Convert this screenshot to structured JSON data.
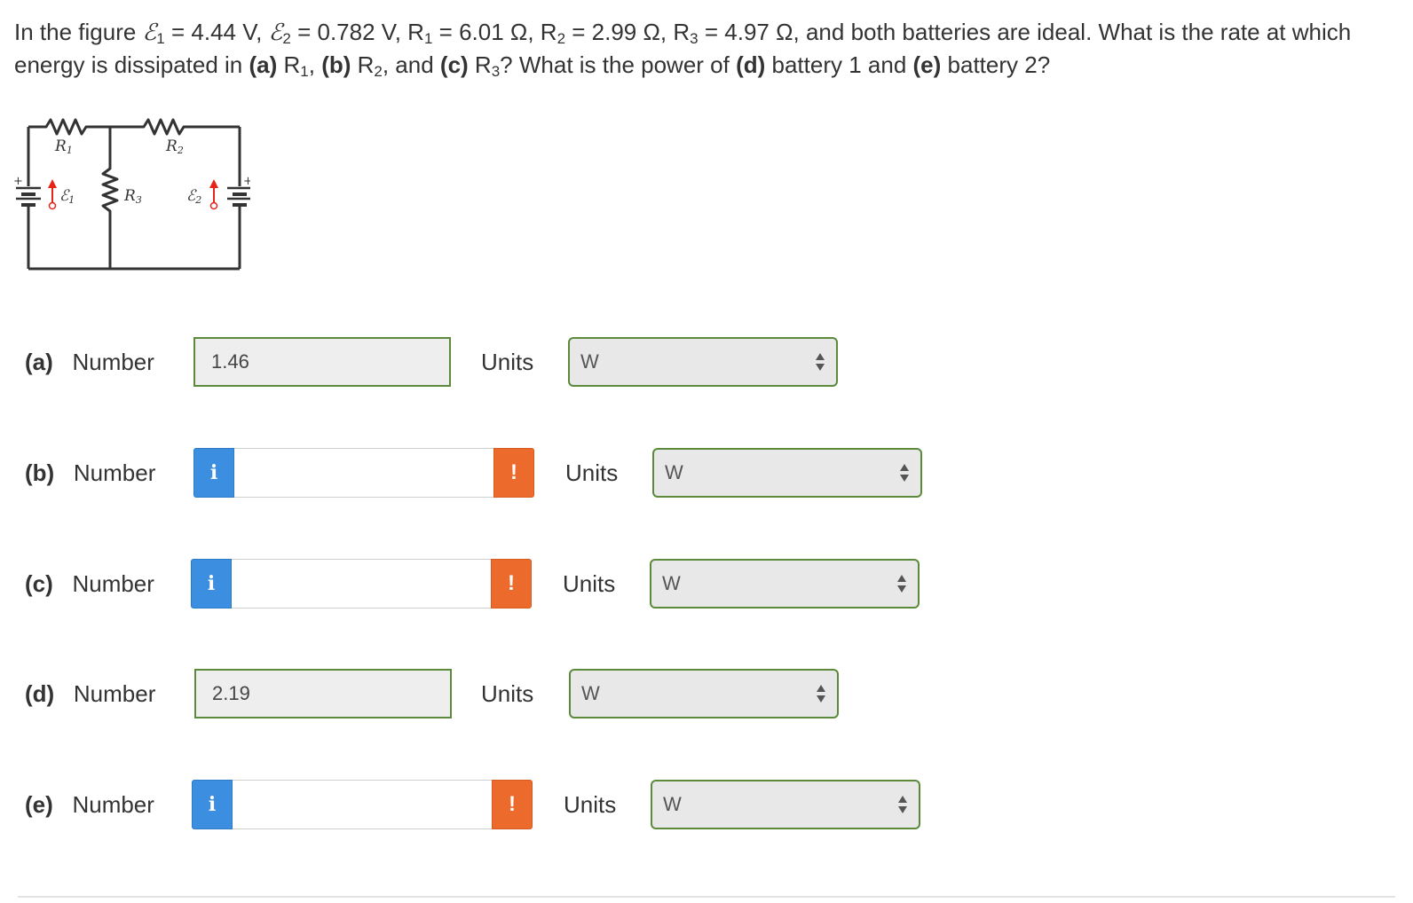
{
  "question": {
    "intro": "In the figure ",
    "emf1_value": " = 4.44 V, ",
    "emf2_value": " = 0.782 V, R",
    "r1_value": " = 6.01 Ω, R",
    "r2_value": " = 2.99 Ω, R",
    "r3_value": " = 4.97 Ω, and both batteries are ideal. What is the rate at which energy is dissipated in ",
    "part_a": "(a)",
    "text_r1": " R",
    "comma1": ", ",
    "part_b": "(b)",
    "text_r2": " R",
    "and": ", and ",
    "part_c": "(c)",
    "text_r3": " R",
    "power_text": "? What is the power of ",
    "part_d": "(d)",
    "battery1": " battery 1 and ",
    "part_e": "(e)",
    "battery2": " battery 2?",
    "emf_symbol": "ℰ",
    "sub1": "1",
    "sub2": "2",
    "sub3": "3"
  },
  "figure": {
    "r1_label": "R",
    "r2_label": "R",
    "r3_label": "R",
    "emf_symbol": "ℰ",
    "sub1": "1",
    "sub2": "2",
    "sub3": "3",
    "plus": "+"
  },
  "rows": [
    {
      "letter": "(a)",
      "label": "Number",
      "value": "1.46",
      "state": "filled",
      "units_label": "Units",
      "unit": "W"
    },
    {
      "letter": "(b)",
      "label": "Number",
      "value": "",
      "state": "empty",
      "units_label": "Units",
      "unit": "W"
    },
    {
      "letter": "(c)",
      "label": "Number",
      "value": "",
      "state": "empty",
      "units_label": "Units",
      "unit": "W"
    },
    {
      "letter": "(d)",
      "label": "Number",
      "value": "2.19",
      "state": "filled",
      "units_label": "Units",
      "unit": "W"
    },
    {
      "letter": "(e)",
      "label": "Number",
      "value": "",
      "state": "empty",
      "units_label": "Units",
      "unit": "W"
    }
  ],
  "buttons": {
    "info_glyph": "i",
    "warn_glyph": "!"
  },
  "colors": {
    "correct_border": "#5a8a3a",
    "info": "#3b8ee0",
    "warning": "#ec6a2c",
    "arrow_red": "#e8231a"
  }
}
